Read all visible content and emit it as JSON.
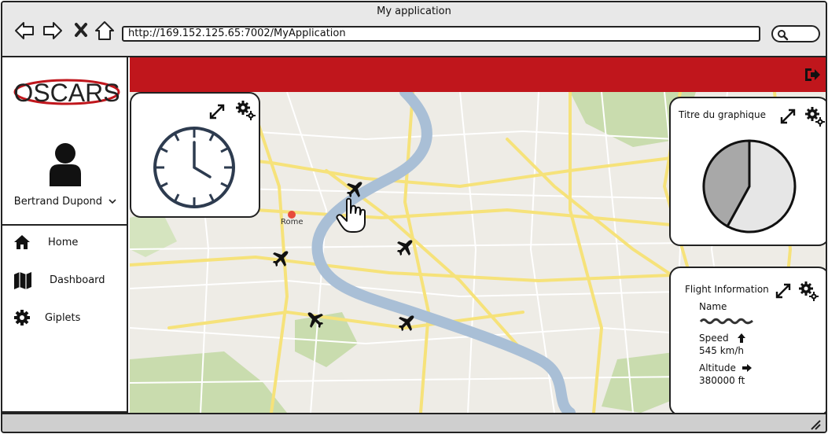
{
  "window": {
    "title": "My application",
    "url": "http://169.152.125.65:7002/MyApplication"
  },
  "sidebar": {
    "logo_text": "OSCARS",
    "user_name": "Bertrand Dupond",
    "items": [
      {
        "label": "Home",
        "icon": "home-icon"
      },
      {
        "label": "Dashboard",
        "icon": "map-icon"
      },
      {
        "label": "Giplets",
        "icon": "gear-icon"
      }
    ]
  },
  "map": {
    "city_label": "Rome"
  },
  "chart_panel": {
    "title": "Titre du graphique"
  },
  "chart_data": {
    "type": "pie",
    "title": "Titre du graphique",
    "values": [
      58,
      42
    ],
    "colors": [
      "#e6e6e6",
      "#a8a8a8"
    ]
  },
  "flight_panel": {
    "title": "Flight Information",
    "name_label": "Name",
    "speed_label": "Speed",
    "speed_value": "545 km/h",
    "altitude_label": "Altitude",
    "altitude_value": "380000 ft"
  },
  "colors": {
    "header_red": "#c0161c",
    "titlebar_gray": "#e8e8e8",
    "map_road": "#f6e27a",
    "map_river": "#a9bfd6",
    "map_park": "#c9dcae"
  }
}
